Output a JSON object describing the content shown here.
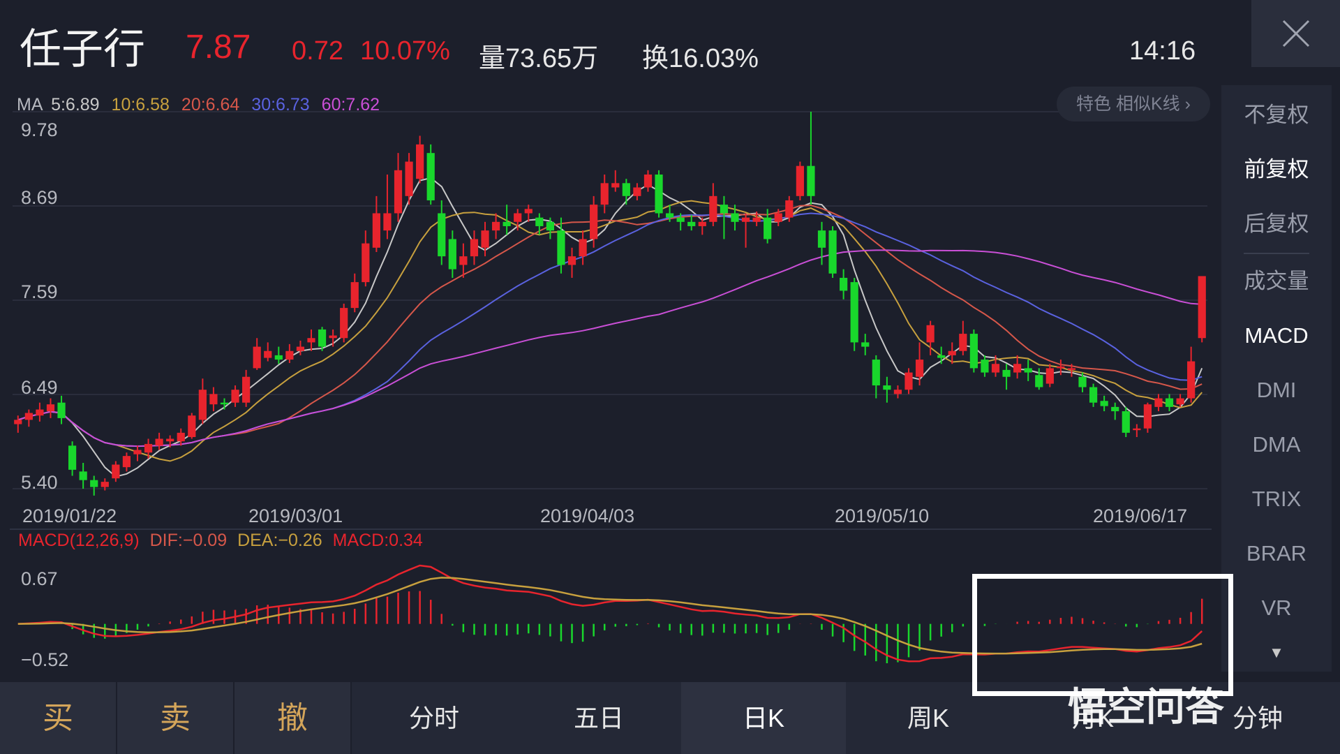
{
  "header": {
    "stock_name": "任子行",
    "price": "7.87",
    "change": "0.72",
    "change_pct": "10.07%",
    "volume": "量73.65万",
    "turnover": "换16.03%",
    "time": "14:16",
    "close_icon": "close-icon"
  },
  "colors": {
    "up": "#e8242d",
    "down": "#19d72c",
    "ma5": "#c8c8c8",
    "ma10": "#c7a03e",
    "ma20": "#d6574a",
    "ma30": "#5a62e0",
    "ma60": "#c94fd6",
    "background": "#1c1f2b"
  },
  "ma_legend": {
    "prefix": "MA",
    "ma5": "5:6.89",
    "ma10": "10:6.58",
    "ma20": "20:6.64",
    "ma30": "30:6.73",
    "ma60": "60:7.62"
  },
  "similar_badge": "特色  相似K线 ›",
  "price_axis": [
    "9.78",
    "8.69",
    "7.59",
    "6.49",
    "5.40"
  ],
  "date_axis": [
    "2019/01/22",
    "2019/03/01",
    "2019/04/03",
    "2019/05/10",
    "2019/06/17"
  ],
  "macd_legend": {
    "title": "MACD(12,26,9)",
    "dif": "DIF:−0.09",
    "dea": "DEA:−0.26",
    "macd": "MACD:0.34"
  },
  "macd_axis": [
    "0.67",
    "−0.52"
  ],
  "right_menu": {
    "items": [
      {
        "label": "不复权",
        "active": false
      },
      {
        "label": "前复权",
        "active": true
      },
      {
        "label": "后复权",
        "active": false
      },
      {
        "label": "成交量",
        "active": false
      },
      {
        "label": "MACD",
        "active": true
      },
      {
        "label": "DMI",
        "active": false
      },
      {
        "label": "DMA",
        "active": false
      },
      {
        "label": "TRIX",
        "active": false
      },
      {
        "label": "BRAR",
        "active": false
      },
      {
        "label": "VR",
        "active": false
      }
    ],
    "more_icon": "▼"
  },
  "bottom_bar": {
    "buy": "买",
    "sell": "卖",
    "cancel": "撤",
    "periods": [
      "分时",
      "五日",
      "日K",
      "周K",
      "月K",
      "分钟"
    ],
    "active_period": "日K"
  },
  "watermark": "悟空问答",
  "chart_data": {
    "type": "candlestick",
    "y_range": [
      5.4,
      9.78
    ],
    "candles": [
      [
        6.15,
        6.2,
        6.05,
        6.25
      ],
      [
        6.2,
        6.28,
        6.12,
        6.32
      ],
      [
        6.25,
        6.32,
        6.18,
        6.4
      ],
      [
        6.3,
        6.38,
        6.22,
        6.45
      ],
      [
        6.4,
        6.22,
        6.15,
        6.48
      ],
      [
        5.9,
        5.62,
        5.55,
        5.95
      ],
      [
        5.6,
        5.5,
        5.4,
        5.7
      ],
      [
        5.5,
        5.42,
        5.32,
        5.55
      ],
      [
        5.42,
        5.48,
        5.38,
        5.52
      ],
      [
        5.52,
        5.68,
        5.48,
        5.72
      ],
      [
        5.65,
        5.78,
        5.6,
        5.82
      ],
      [
        5.8,
        5.85,
        5.72,
        5.9
      ],
      [
        5.82,
        5.92,
        5.75,
        5.98
      ],
      [
        5.9,
        5.98,
        5.85,
        6.05
      ],
      [
        5.95,
        5.98,
        5.88,
        6.02
      ],
      [
        5.95,
        6.05,
        5.9,
        6.1
      ],
      [
        6.0,
        6.25,
        5.98,
        6.28
      ],
      [
        6.2,
        6.55,
        6.15,
        6.68
      ],
      [
        6.38,
        6.5,
        6.3,
        6.58
      ],
      [
        6.4,
        6.38,
        6.32,
        6.45
      ],
      [
        6.4,
        6.55,
        6.35,
        6.6
      ],
      [
        6.4,
        6.7,
        6.35,
        6.78
      ],
      [
        6.8,
        7.05,
        6.78,
        7.15
      ],
      [
        6.92,
        7.0,
        6.88,
        7.1
      ],
      [
        6.95,
        6.9,
        6.85,
        7.05
      ],
      [
        6.9,
        7.0,
        6.86,
        7.08
      ],
      [
        7.0,
        7.05,
        6.95,
        7.12
      ],
      [
        7.1,
        7.15,
        7.0,
        7.25
      ],
      [
        7.25,
        7.05,
        7.0,
        7.28
      ],
      [
        7.15,
        7.18,
        7.05,
        7.25
      ],
      [
        7.15,
        7.5,
        7.1,
        7.55
      ],
      [
        7.5,
        7.8,
        7.45,
        7.9
      ],
      [
        7.8,
        8.25,
        7.75,
        8.4
      ],
      [
        8.2,
        8.6,
        8.15,
        8.8
      ],
      [
        8.4,
        8.6,
        8.3,
        9.05
      ],
      [
        8.6,
        9.1,
        8.5,
        9.3
      ],
      [
        8.8,
        9.2,
        8.7,
        9.3
      ],
      [
        9.0,
        9.4,
        8.95,
        9.5
      ],
      [
        9.3,
        8.75,
        8.7,
        9.4
      ],
      [
        8.6,
        8.1,
        8.0,
        8.75
      ],
      [
        8.3,
        7.95,
        7.85,
        8.4
      ],
      [
        8.0,
        8.1,
        7.85,
        8.25
      ],
      [
        8.1,
        8.3,
        8.0,
        8.4
      ],
      [
        8.2,
        8.4,
        8.1,
        8.5
      ],
      [
        8.4,
        8.5,
        8.3,
        8.6
      ],
      [
        8.5,
        8.45,
        8.35,
        8.7
      ],
      [
        8.5,
        8.6,
        8.4,
        8.65
      ],
      [
        8.6,
        8.65,
        8.5,
        8.7
      ],
      [
        8.55,
        8.45,
        8.35,
        8.6
      ],
      [
        8.5,
        8.4,
        8.3,
        8.55
      ],
      [
        8.4,
        8.0,
        7.9,
        8.55
      ],
      [
        8.0,
        8.1,
        7.85,
        8.2
      ],
      [
        8.1,
        8.3,
        8.0,
        8.4
      ],
      [
        8.3,
        8.7,
        8.2,
        8.8
      ],
      [
        8.7,
        8.95,
        8.6,
        9.05
      ],
      [
        8.9,
        8.95,
        8.85,
        9.1
      ],
      [
        8.95,
        8.8,
        8.7,
        9.0
      ],
      [
        8.8,
        8.9,
        8.75,
        8.95
      ],
      [
        8.9,
        9.05,
        8.85,
        9.1
      ],
      [
        9.05,
        8.6,
        8.55,
        9.1
      ],
      [
        8.6,
        8.55,
        8.5,
        8.7
      ],
      [
        8.55,
        8.5,
        8.4,
        8.6
      ],
      [
        8.5,
        8.45,
        8.4,
        8.58
      ],
      [
        8.45,
        8.5,
        8.35,
        8.55
      ],
      [
        8.5,
        8.8,
        8.45,
        8.95
      ],
      [
        8.7,
        8.6,
        8.3,
        8.8
      ],
      [
        8.6,
        8.5,
        8.4,
        8.7
      ],
      [
        8.5,
        8.55,
        8.2,
        8.6
      ],
      [
        8.5,
        8.55,
        8.45,
        8.62
      ],
      [
        8.55,
        8.3,
        8.25,
        8.65
      ],
      [
        8.5,
        8.6,
        8.45,
        8.65
      ],
      [
        8.55,
        8.75,
        8.5,
        8.8
      ],
      [
        8.8,
        9.15,
        8.75,
        9.2
      ],
      [
        9.15,
        8.8,
        8.7,
        9.78
      ],
      [
        8.4,
        8.2,
        8.0,
        8.5
      ],
      [
        8.4,
        7.9,
        7.85,
        8.45
      ],
      [
        7.85,
        7.7,
        7.6,
        7.95
      ],
      [
        7.8,
        7.1,
        7.0,
        7.85
      ],
      [
        7.1,
        7.05,
        6.95,
        7.2
      ],
      [
        6.9,
        6.6,
        6.45,
        6.95
      ],
      [
        6.6,
        6.55,
        6.4,
        6.7
      ],
      [
        6.5,
        6.55,
        6.45,
        6.6
      ],
      [
        6.55,
        6.75,
        6.5,
        6.8
      ],
      [
        6.7,
        6.9,
        6.6,
        7.1
      ],
      [
        7.1,
        7.3,
        6.95,
        7.35
      ],
      [
        6.95,
        6.92,
        6.85,
        7.05
      ],
      [
        6.95,
        7.0,
        6.85,
        7.1
      ],
      [
        7.0,
        7.2,
        6.95,
        7.35
      ],
      [
        7.2,
        6.8,
        6.75,
        7.25
      ],
      [
        6.9,
        6.75,
        6.7,
        6.95
      ],
      [
        6.75,
        6.85,
        6.7,
        6.95
      ],
      [
        6.78,
        6.7,
        6.55,
        6.85
      ],
      [
        6.75,
        6.85,
        6.68,
        6.95
      ],
      [
        6.8,
        6.75,
        6.65,
        6.9
      ],
      [
        6.72,
        6.58,
        6.55,
        6.8
      ],
      [
        6.62,
        6.8,
        6.58,
        6.85
      ],
      [
        6.8,
        6.82,
        6.72,
        6.9
      ],
      [
        6.78,
        6.8,
        6.7,
        6.85
      ],
      [
        6.7,
        6.58,
        6.52,
        6.75
      ],
      [
        6.58,
        6.4,
        6.35,
        6.62
      ],
      [
        6.42,
        6.36,
        6.3,
        6.48
      ],
      [
        6.35,
        6.3,
        6.2,
        6.4
      ],
      [
        6.3,
        6.05,
        6.0,
        6.35
      ],
      [
        6.08,
        6.1,
        6.0,
        6.15
      ],
      [
        6.1,
        6.38,
        6.05,
        6.4
      ],
      [
        6.35,
        6.45,
        6.3,
        6.5
      ],
      [
        6.45,
        6.35,
        6.3,
        6.5
      ],
      [
        6.38,
        6.45,
        6.35,
        6.5
      ],
      [
        6.45,
        6.88,
        6.4,
        7.05
      ],
      [
        7.15,
        7.87,
        7.1,
        7.87
      ]
    ]
  }
}
